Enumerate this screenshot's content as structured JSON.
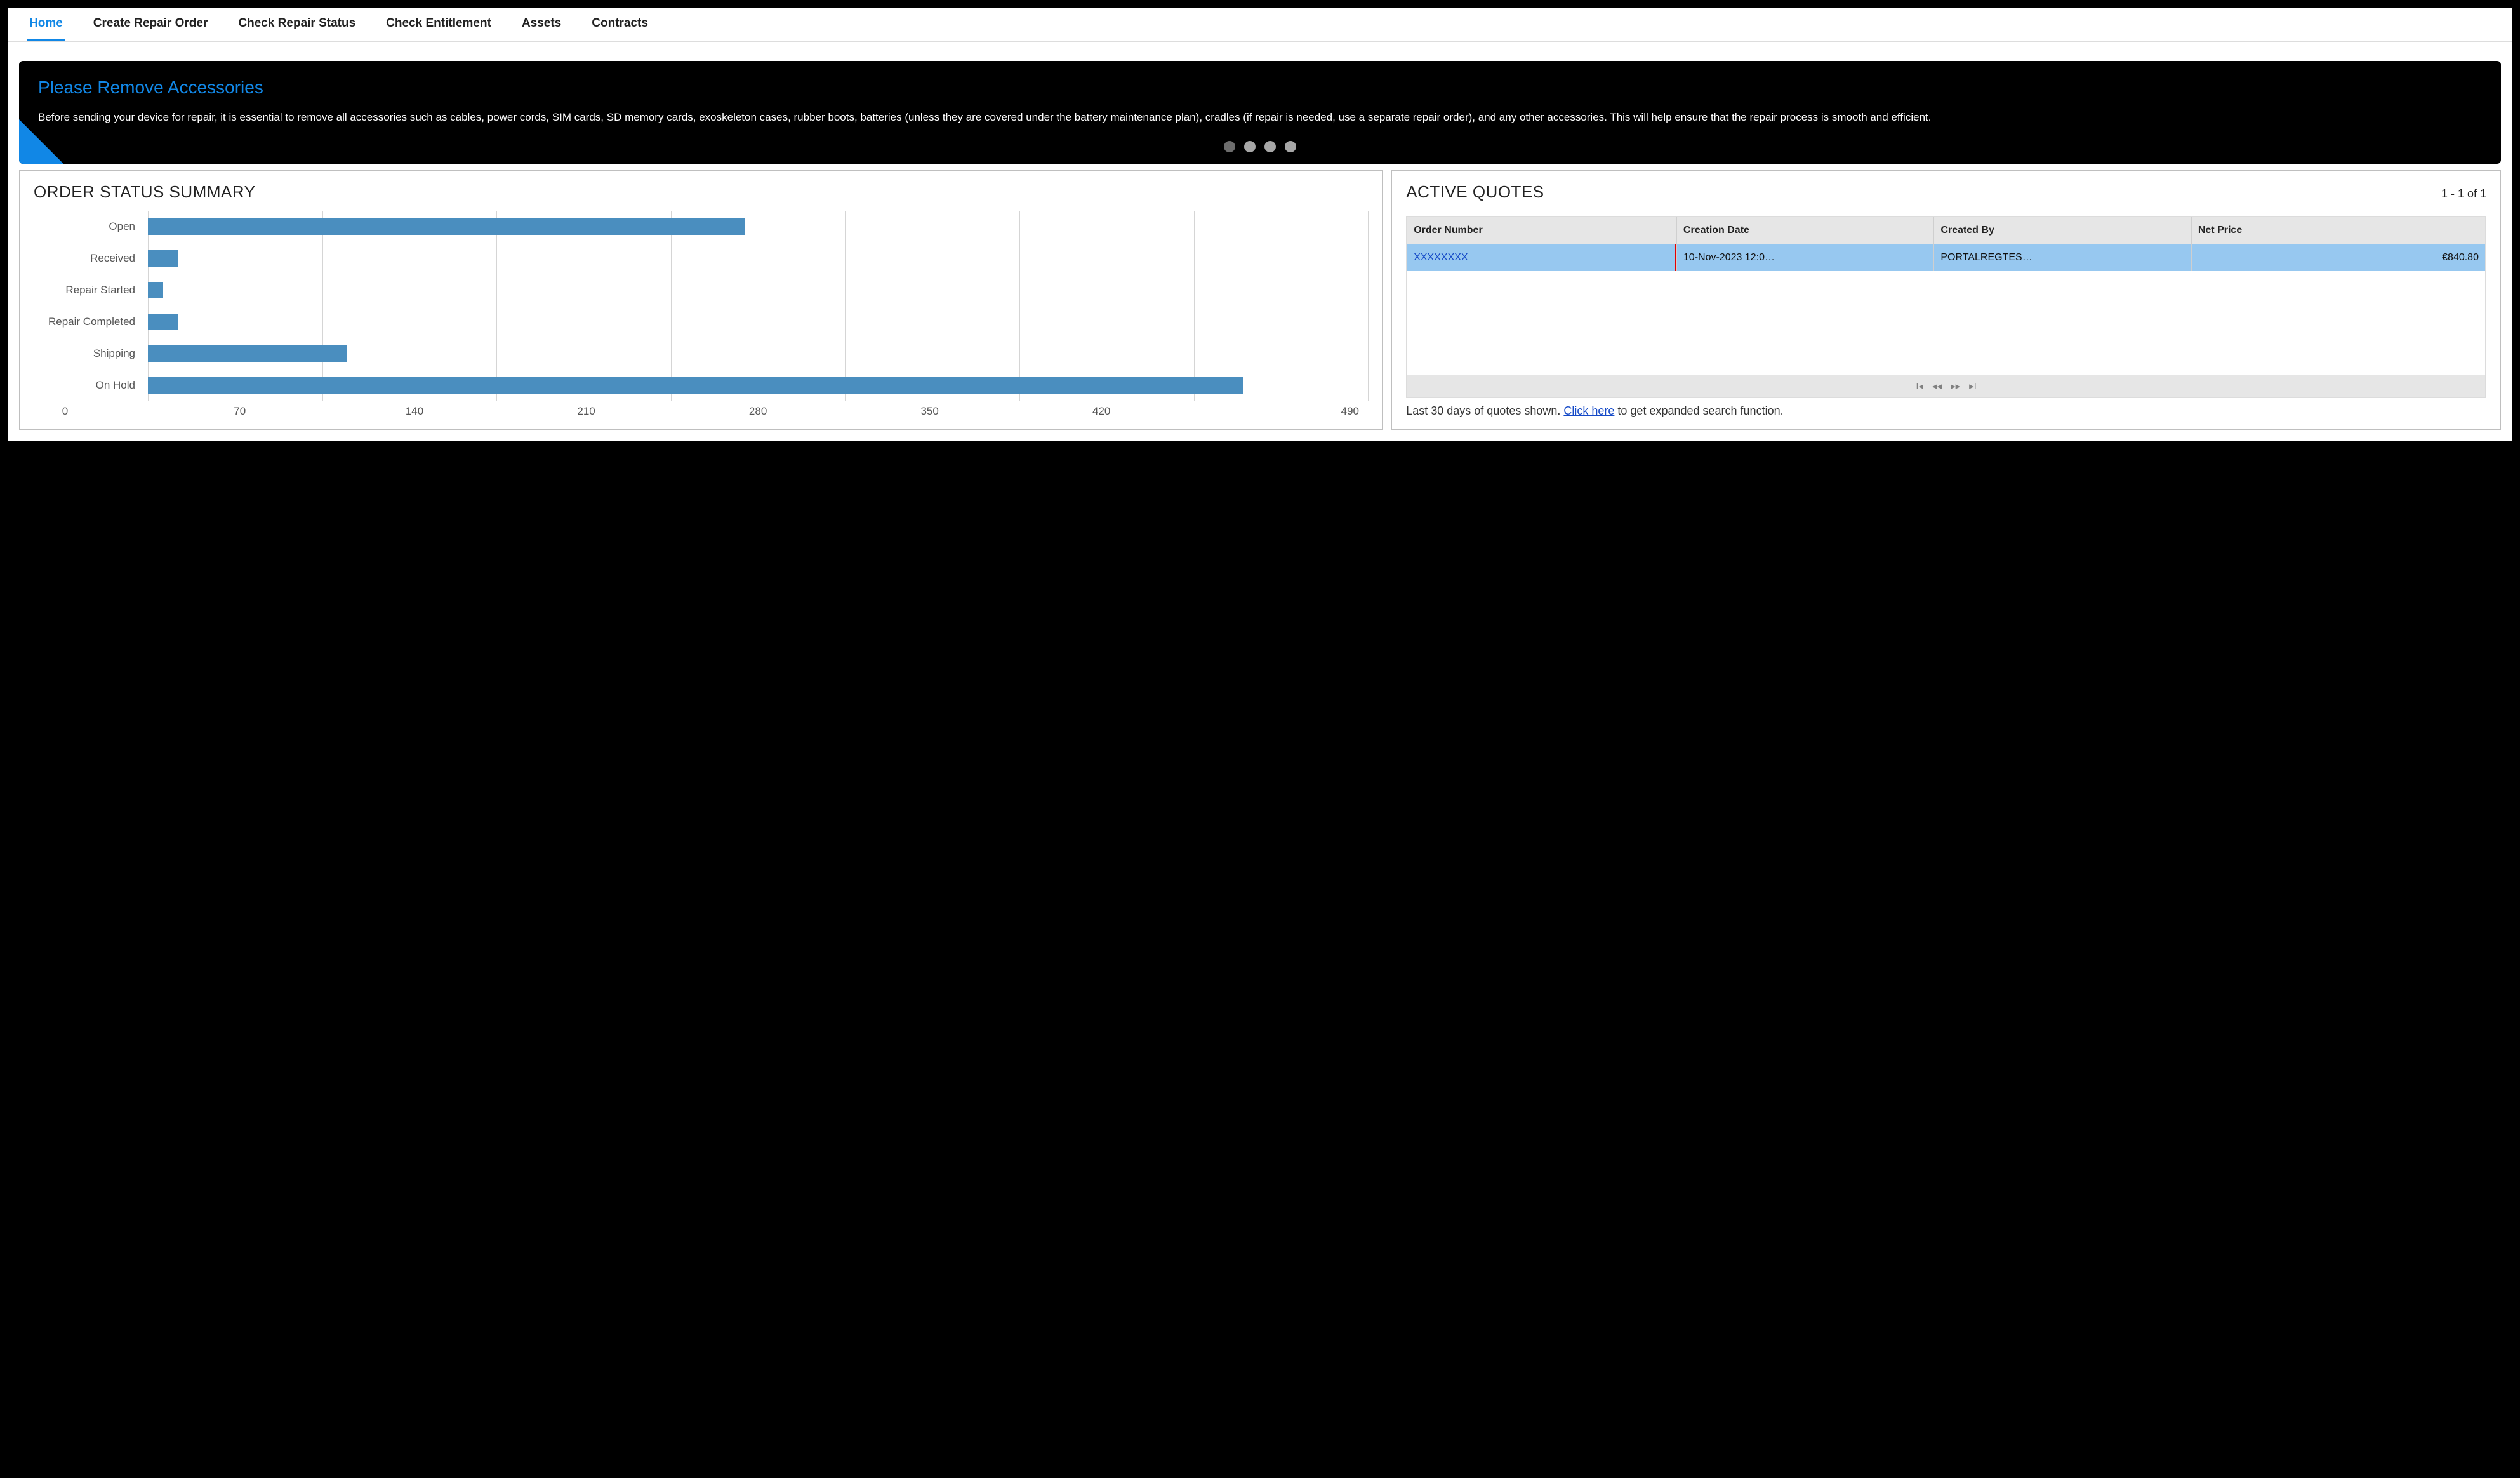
{
  "nav": {
    "items": [
      {
        "label": "Home",
        "active": true
      },
      {
        "label": "Create Repair Order",
        "active": false
      },
      {
        "label": "Check Repair Status",
        "active": false
      },
      {
        "label": "Check Entitlement",
        "active": false
      },
      {
        "label": "Assets",
        "active": false
      },
      {
        "label": "Contracts",
        "active": false
      }
    ]
  },
  "banner": {
    "title": "Please Remove Accessories",
    "body": "Before sending your device for repair, it is essential to remove all accessories such as cables, power cords, SIM cards, SD memory cards, exoskeleton cases, rubber boots, batteries (unless they are covered under the battery maintenance plan), cradles (if repair is needed, use a separate repair order), and any other accessories. This will help ensure that the repair process is smooth and efficient.",
    "dot_count": 4,
    "active_dot_index": 0
  },
  "status_panel": {
    "title": "ORDER STATUS SUMMARY"
  },
  "chart_data": {
    "type": "bar",
    "orientation": "horizontal",
    "categories": [
      "Open",
      "Received",
      "Repair Started",
      "Repair Completed",
      "Shipping",
      "On Hold"
    ],
    "values": [
      240,
      12,
      6,
      12,
      80,
      440
    ],
    "x_ticks": [
      0,
      70,
      140,
      210,
      280,
      350,
      420,
      490
    ],
    "xlim": [
      0,
      490
    ],
    "bar_color": "#4a8ebf",
    "title": "",
    "xlabel": "",
    "ylabel": ""
  },
  "quotes_panel": {
    "title": "ACTIVE QUOTES",
    "count_label": "1 - 1 of 1",
    "columns": {
      "order_number": "Order Number",
      "creation_date": "Creation Date",
      "created_by": "Created By",
      "net_price": "Net Price"
    },
    "rows": [
      {
        "order_number": "XXXXXXXX",
        "creation_date": "10-Nov-2023 12:0…",
        "created_by": "PORTALREGTES…",
        "net_price": "€840.80",
        "highlighted": true
      }
    ],
    "footnote_pre": "Last 30 days of quotes shown. ",
    "footnote_link": "Click here",
    "footnote_post": " to get expanded search function.",
    "pager_icons": {
      "first": "⏮",
      "prev": "◀◀",
      "next": "▶▶",
      "last": "⏭"
    }
  }
}
